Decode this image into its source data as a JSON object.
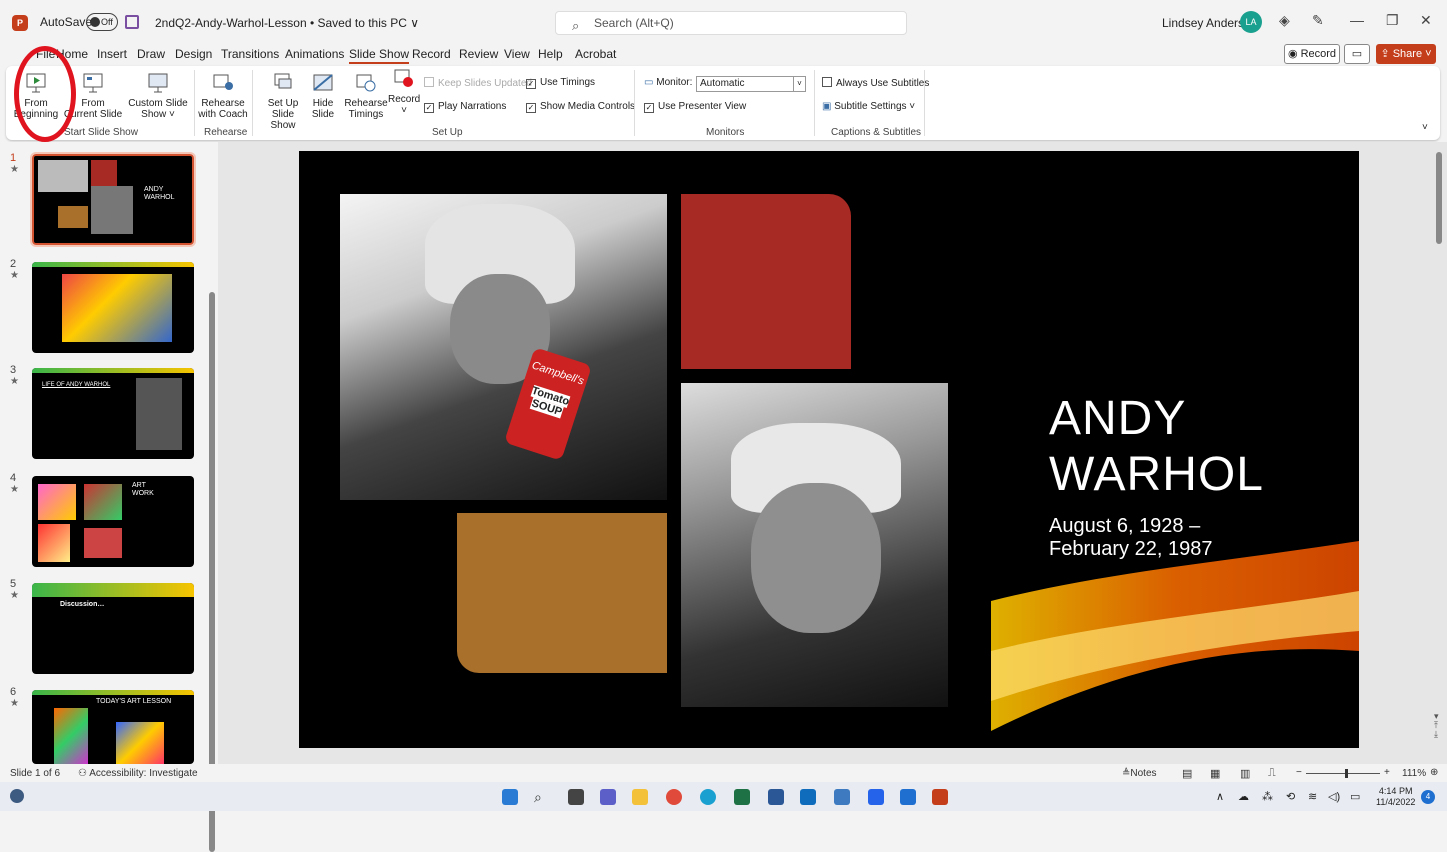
{
  "titlebar": {
    "autosave_label": "AutoSave",
    "autosave_state": "Off",
    "doc_title": "2ndQ2-Andy-Warhol-Lesson • Saved to this PC ∨",
    "search_placeholder": "Search (Alt+Q)",
    "user_name": "Lindsey Anderson",
    "avatar_initials": "LA"
  },
  "menu": {
    "items": [
      "File",
      "Home",
      "Insert",
      "Draw",
      "Design",
      "Transitions",
      "Animations",
      "Slide Show",
      "Record",
      "Review",
      "View",
      "Help",
      "Acrobat"
    ],
    "active": "Slide Show",
    "record_label": "◉ Record",
    "share_label": "Share"
  },
  "ribbon": {
    "from_beginning": [
      "From",
      "Beginning"
    ],
    "from_current": [
      "From",
      "Current Slide"
    ],
    "custom_show": [
      "Custom Slide",
      "Show ˅"
    ],
    "start_group": "Start Slide Show",
    "rehearse_coach": [
      "Rehearse",
      "with Coach"
    ],
    "rehearse_group": "Rehearse",
    "setup_show": [
      "Set Up",
      "Slide Show"
    ],
    "hide_slide": [
      "Hide",
      "Slide"
    ],
    "rehearse_timings": [
      "Rehearse",
      "Timings"
    ],
    "record": [
      "Record",
      "˅"
    ],
    "keep_updated": "Keep Slides Updated",
    "play_narrations": "Play Narrations",
    "use_timings": "Use Timings",
    "show_media": "Show Media Controls",
    "setup_group": "Set Up",
    "monitor_label": "Monitor:",
    "monitor_value": "Automatic",
    "presenter_view": "Use Presenter View",
    "monitors_group": "Monitors",
    "always_subtitles": "Always Use Subtitles",
    "subtitle_settings": "Subtitle Settings ˅",
    "captions_group": "Captions & Subtitles"
  },
  "thumbnails": [
    {
      "num": "1",
      "title": "ANDY WARHOL"
    },
    {
      "num": "2",
      "title": ""
    },
    {
      "num": "3",
      "title": "LIFE OF ANDY WARHOL"
    },
    {
      "num": "4",
      "title": "ART WORK"
    },
    {
      "num": "5",
      "title": "Discussion…"
    },
    {
      "num": "6",
      "title": "TODAY'S ART LESSON"
    }
  ],
  "slide": {
    "title_line1": "ANDY",
    "title_line2": "WARHOL",
    "sub_line1": "August 6, 1928 –",
    "sub_line2": "February 22, 1987",
    "can_text1": "Campbell's",
    "can_text2": "Tomato",
    "can_text3": "SOUP"
  },
  "status": {
    "slide_of": "Slide 1 of 6",
    "accessibility": "Accessibility: Investigate",
    "notes": "≜Notes",
    "zoom": "111%"
  },
  "tray": {
    "time": "4:14 PM",
    "date": "11/4/2022",
    "notif_count": "4"
  },
  "colors": {
    "accent": "#c43e1c",
    "slide_red": "#a72a24",
    "slide_gold": "#a8702a"
  }
}
